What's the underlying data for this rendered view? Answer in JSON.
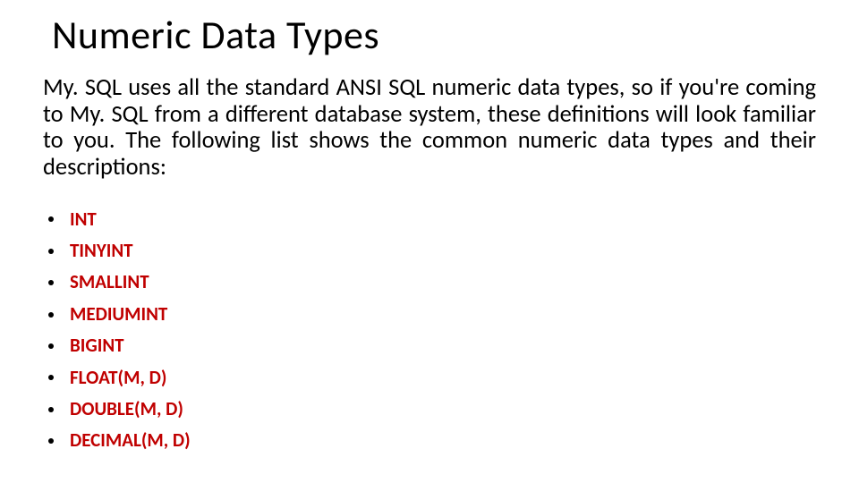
{
  "title": "Numeric Data Types",
  "body": "My. SQL uses all the standard ANSI SQL numeric data types, so if you're coming to My. SQL from a different database system, these definitions will look familiar to you. The following list shows the common numeric data types and their descriptions:",
  "types": [
    "INT",
    "TINYINT",
    "SMALLINT",
    "MEDIUMINT",
    "BIGINT",
    "FLOAT(M, D)",
    "DOUBLE(M, D)",
    "DECIMAL(M, D)"
  ],
  "colors": {
    "type_text": "#C00000",
    "bullet": "#000000"
  }
}
